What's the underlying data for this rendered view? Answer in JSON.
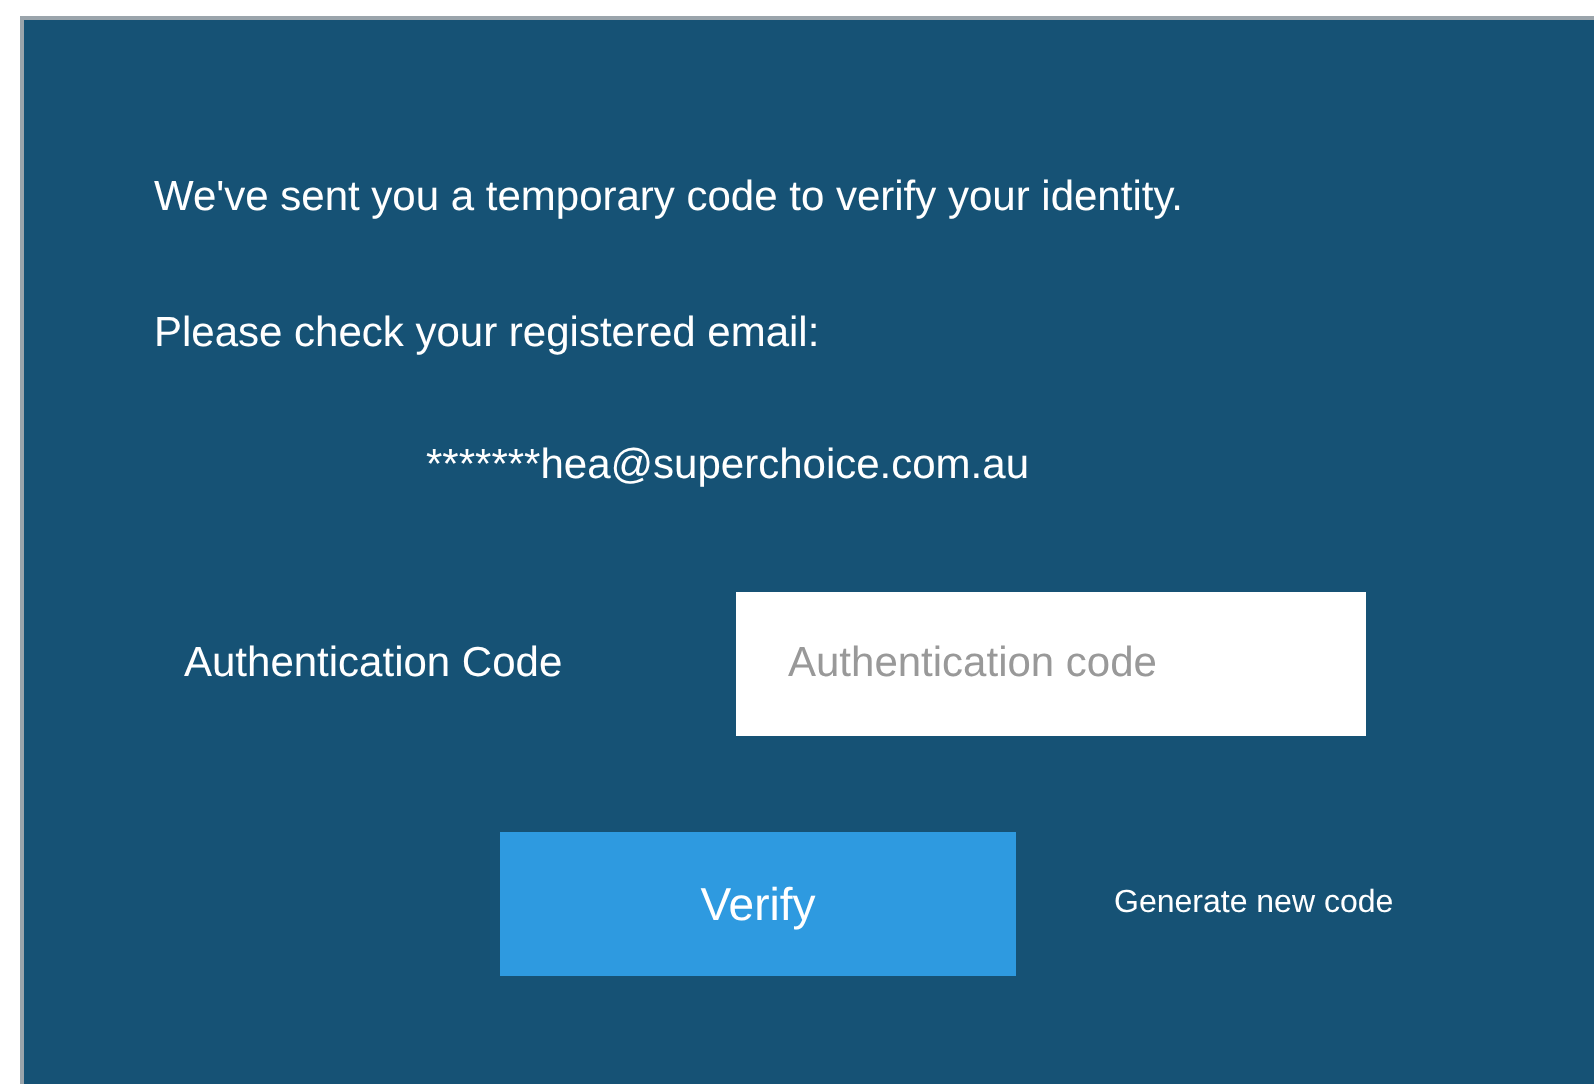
{
  "message_lines": [
    "We've sent you a temporary code to verify your identity.",
    "Please check your registered email:"
  ],
  "email": "*******hea@superchoice.com.au",
  "code_field": {
    "label": "Authentication Code",
    "placeholder": "Authentication code"
  },
  "verify_button": "Verify",
  "generate_link": "Generate new code"
}
